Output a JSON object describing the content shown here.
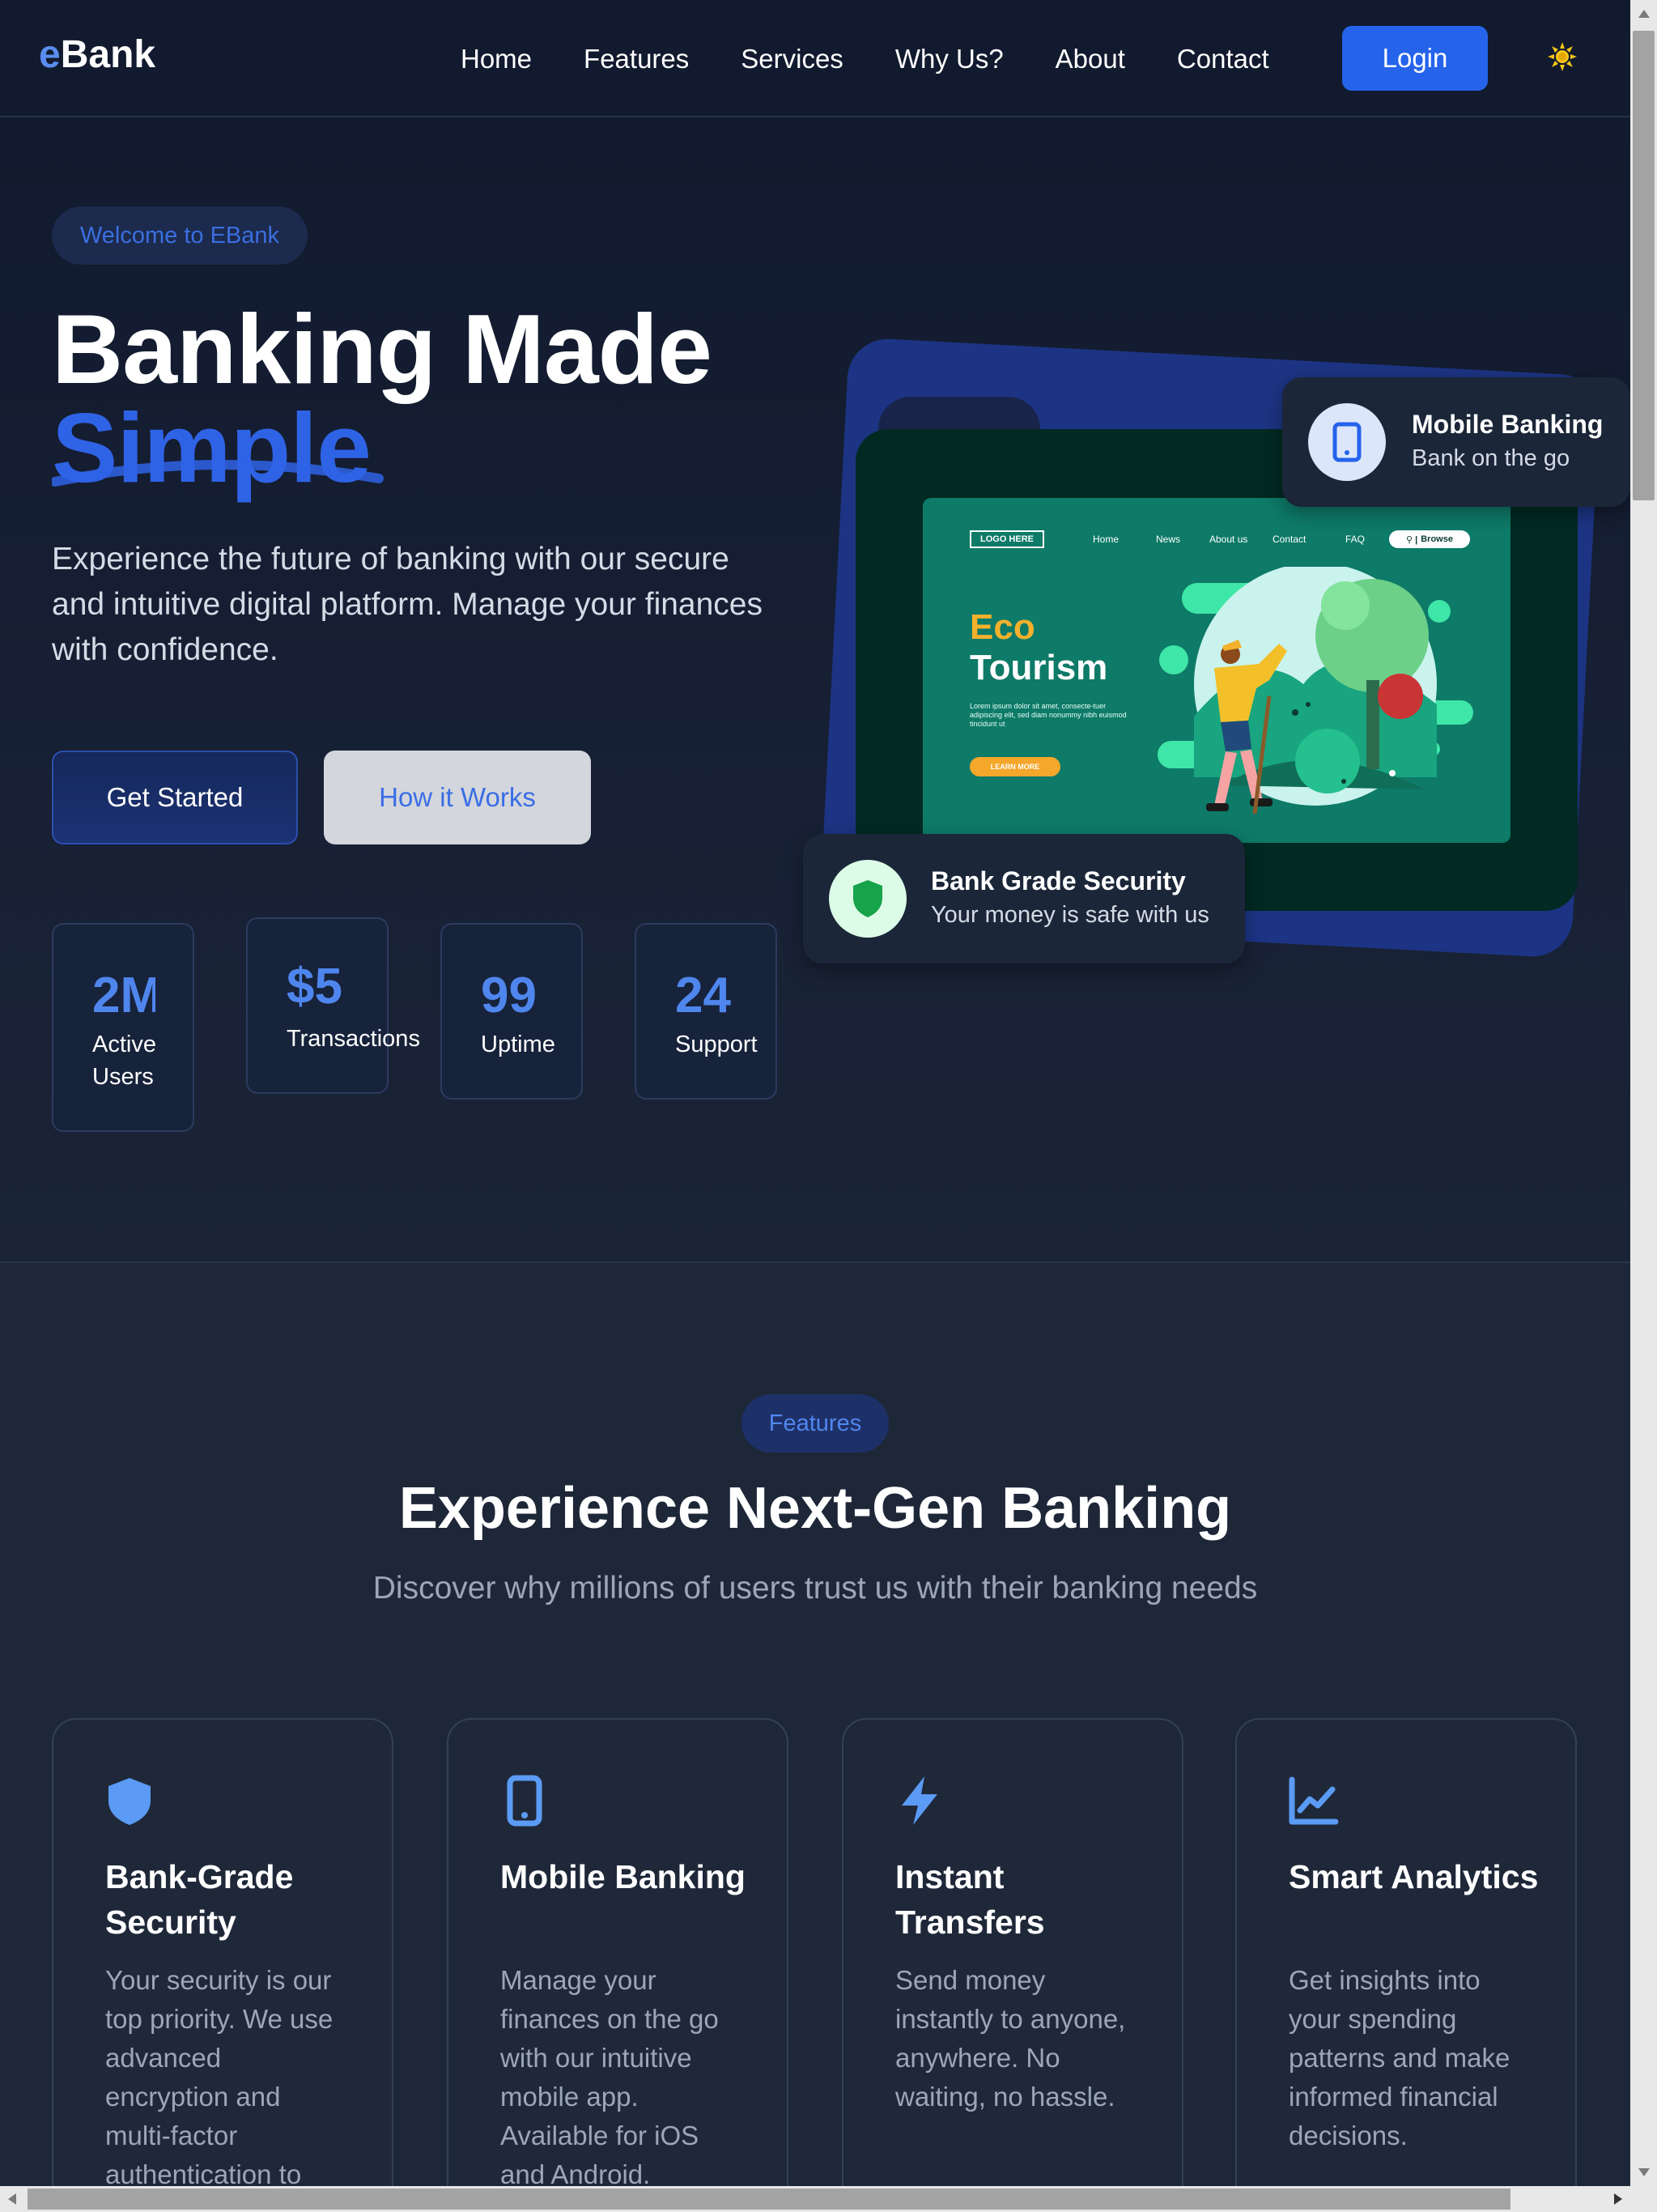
{
  "nav": {
    "logo_prefix": "e",
    "logo_suffix": "Bank",
    "links": [
      "Home",
      "Features",
      "Services",
      "Why Us?",
      "About",
      "Contact"
    ],
    "login_label": "Login",
    "theme_icon": "sun-icon"
  },
  "hero": {
    "pill": "Welcome to EBank",
    "title_line1": "Banking Made",
    "title_accent": "Simple",
    "description": "Experience the future of banking with our secure and intuitive digital platform. Manage your finances with confidence.",
    "get_started": "Get Started",
    "how_it_works": "How it Works",
    "stats": [
      {
        "value": "2M",
        "label": "Active Users"
      },
      {
        "value": "$5",
        "label": "Transactions"
      },
      {
        "value": "99",
        "label": "Uptime"
      },
      {
        "value": "24",
        "label": "Support"
      }
    ],
    "mockup": {
      "logo": "LOGO HERE",
      "nav": [
        "Home",
        "News",
        "About us",
        "Contact",
        "FAQ"
      ],
      "search": "Browse",
      "heading_accent": "Eco",
      "heading": "Tourism",
      "lorem": "Lorem ipsum dolor sit amet, consecte-tuer adipiscing elit, sed diam nonummy nibh euismod tincidunt ut",
      "button": "LEARN MORE"
    },
    "cards": {
      "mobile_title": "Mobile Banking",
      "mobile_sub": "Bank on the go",
      "security_title": "Bank Grade Security",
      "security_sub": "Your money is safe with us"
    }
  },
  "features": {
    "pill": "Features",
    "title": "Experience Next-Gen Banking",
    "subtitle": "Discover why millions of users trust us with their banking needs",
    "cards": [
      {
        "icon": "shield-icon",
        "title": "Bank-Grade Security",
        "description": "Your security is our top priority. We use advanced encryption and multi-factor authentication to"
      },
      {
        "icon": "mobile-icon",
        "title": "Mobile Banking",
        "description": "Manage your finances on the go with our intuitive mobile app. Available for iOS and Android."
      },
      {
        "icon": "bolt-icon",
        "title": "Instant Transfers",
        "description": "Send money instantly to anyone, anywhere. No waiting, no hassle."
      },
      {
        "icon": "chart-line-icon",
        "title": "Smart Analytics",
        "description": "Get insights into your spending patterns and make informed financial decisions."
      }
    ]
  },
  "colors": {
    "accent": "#2563eb",
    "accent_light": "#4f86ee",
    "background": "#1e2738",
    "nav_background": "#111a2e",
    "security_green": "#16a34a"
  }
}
